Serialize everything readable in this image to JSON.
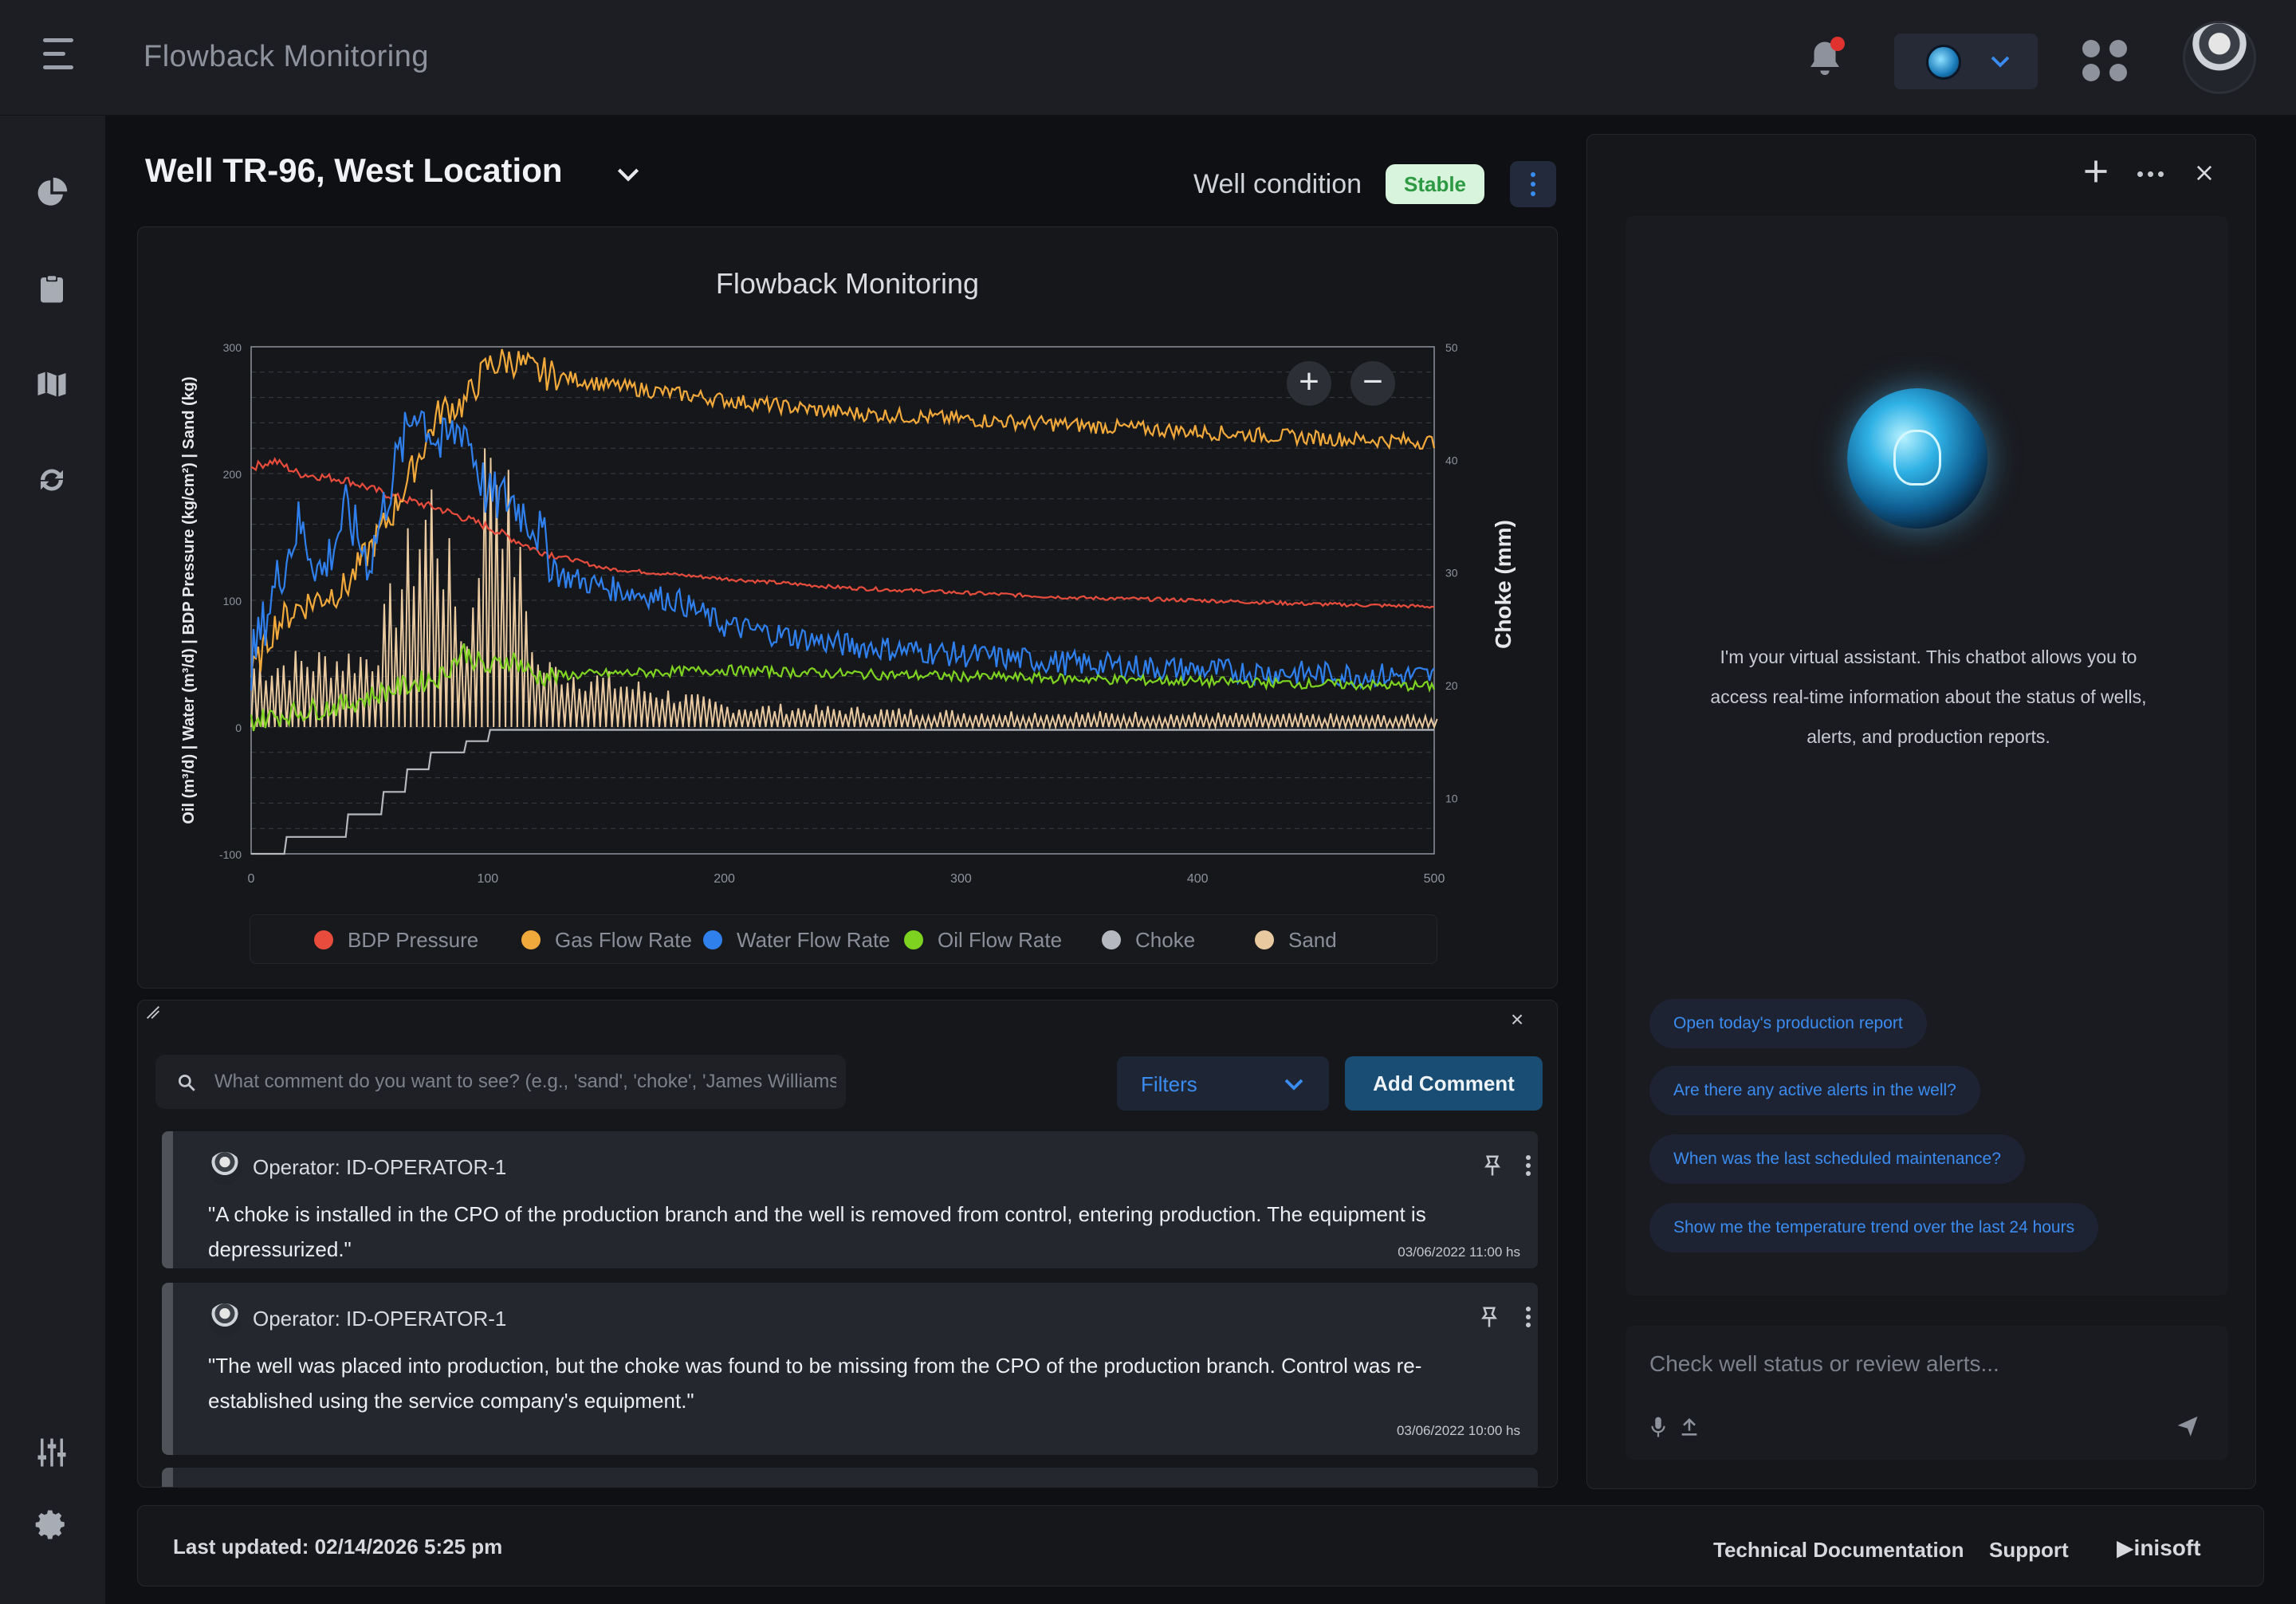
{
  "app": {
    "title": "Flowback Monitoring"
  },
  "well": {
    "name": "Well TR-96, West Location",
    "condition_label": "Well condition",
    "condition_status": "Stable"
  },
  "colors": {
    "accent": "#3b8cf0",
    "stable_bg": "#d9f4dd",
    "stable_text": "#2d9a43",
    "notification": "#e0322f"
  },
  "icons": {
    "menu": "hamburger-icon",
    "notifications": "bell-icon",
    "apps": "grid-icon",
    "sidebar": [
      "pie-chart-icon",
      "clipboard-icon",
      "map-icon",
      "sync-icon",
      "sliders-icon",
      "gear-icon"
    ]
  },
  "chart_data": {
    "type": "line",
    "title": "Flowback Monitoring",
    "ylabel": "Oil (m³/d) | Water (m³/d) | BDP Pressure (kg/cm²) | Sand (kg)",
    "y2label": "Choke (mm)",
    "xlim": [
      0,
      500
    ],
    "ylim": [
      -100,
      300
    ],
    "y2lim": [
      5,
      50
    ],
    "xticks": [
      "0",
      "100",
      "200",
      "300",
      "400",
      "500"
    ],
    "yticks": [
      "-100",
      "0",
      "100",
      "200",
      "300"
    ],
    "y2ticks": [
      "10",
      "20",
      "30",
      "40",
      "50"
    ],
    "grid": true,
    "legend_position": "bottom",
    "series": [
      {
        "name": "BDP Pressure",
        "color": "#e74c3c",
        "axis": "left",
        "x": [
          0,
          10,
          20,
          40,
          60,
          80,
          100,
          120,
          150,
          200,
          250,
          300,
          350,
          400,
          450,
          500
        ],
        "y": [
          205,
          210,
          200,
          195,
          182,
          172,
          158,
          140,
          125,
          117,
          110,
          106,
          102,
          100,
          97,
          95
        ]
      },
      {
        "name": "Gas Flow Rate",
        "color": "#f2a93b",
        "axis": "left",
        "x": [
          0,
          10,
          20,
          40,
          50,
          60,
          70,
          80,
          90,
          100,
          110,
          120,
          150,
          200,
          250,
          300,
          350,
          400,
          450,
          500
        ],
        "y": [
          40,
          80,
          95,
          110,
          140,
          170,
          210,
          250,
          255,
          285,
          290,
          280,
          270,
          258,
          248,
          243,
          238,
          233,
          228,
          225
        ]
      },
      {
        "name": "Water Flow Rate",
        "color": "#2f80ed",
        "axis": "left",
        "x": [
          0,
          10,
          20,
          30,
          40,
          50,
          60,
          70,
          80,
          90,
          100,
          110,
          120,
          130,
          150,
          180,
          200,
          250,
          300,
          350,
          400,
          450,
          500
        ],
        "y": [
          50,
          110,
          160,
          120,
          170,
          130,
          200,
          255,
          220,
          240,
          180,
          180,
          160,
          120,
          110,
          100,
          80,
          65,
          57,
          50,
          45,
          42,
          40
        ]
      },
      {
        "name": "Oil Flow Rate",
        "color": "#7ed321",
        "axis": "left",
        "x": [
          0,
          20,
          40,
          60,
          80,
          90,
          100,
          110,
          120,
          150,
          200,
          250,
          300,
          350,
          400,
          450,
          500
        ],
        "y": [
          5,
          12,
          18,
          30,
          40,
          60,
          45,
          55,
          40,
          42,
          45,
          42,
          40,
          38,
          36,
          34,
          32
        ]
      },
      {
        "name": "Choke",
        "color": "#b5b8be",
        "axis": "right",
        "x": [
          0,
          14,
          15,
          40,
          41,
          55,
          56,
          65,
          66,
          75,
          76,
          90,
          91,
          100,
          101,
          500
        ],
        "y": [
          5,
          5,
          6.5,
          6.5,
          8.5,
          8.5,
          10.5,
          10.5,
          12.5,
          12.5,
          14,
          14,
          15,
          15,
          16,
          16
        ]
      },
      {
        "name": "Sand",
        "color": "#e8c9a0",
        "axis": "left",
        "peak_envelope_x": [
          0,
          50,
          75,
          90,
          100,
          120,
          200,
          300,
          400,
          500
        ],
        "peak_envelope_y": [
          60,
          70,
          220,
          80,
          300,
          60,
          20,
          14,
          12,
          10
        ]
      }
    ]
  },
  "comments": {
    "search_placeholder": "What comment do you want to see? (e.g., 'sand', 'choke', 'James Williams)",
    "filters_label": "Filters",
    "add_label": "Add Comment",
    "items": [
      {
        "author": "Operator: ID-OPERATOR-1",
        "text": "\"A choke is installed in the CPO of the production branch and the well is removed from control, entering production. The equipment is depressurized.\"",
        "date": "03/06/2022 11:00 hs"
      },
      {
        "author": "Operator: ID-OPERATOR-1",
        "text": "\"The well was placed into production, but the choke was found to be missing from the CPO of the production branch. Control was re-established using the service company's equipment.\"",
        "date": "03/06/2022 10:00 hs"
      }
    ]
  },
  "assistant": {
    "intro": "I'm your virtual assistant. This chatbot allows you to access real-time information about the status of wells, alerts, and production reports.",
    "suggestions": [
      "Open today's production report",
      "Are there any active alerts in the well?",
      "When was the last scheduled maintenance?",
      "Show me the temperature trend over the last 24 hours"
    ],
    "input_placeholder": "Check well status or review alerts..."
  },
  "footer": {
    "last_updated": "Last updated: 02/14/2026 5:25 pm",
    "tech_docs": "Technical Documentation",
    "support": "Support",
    "brand": "inisoft"
  }
}
